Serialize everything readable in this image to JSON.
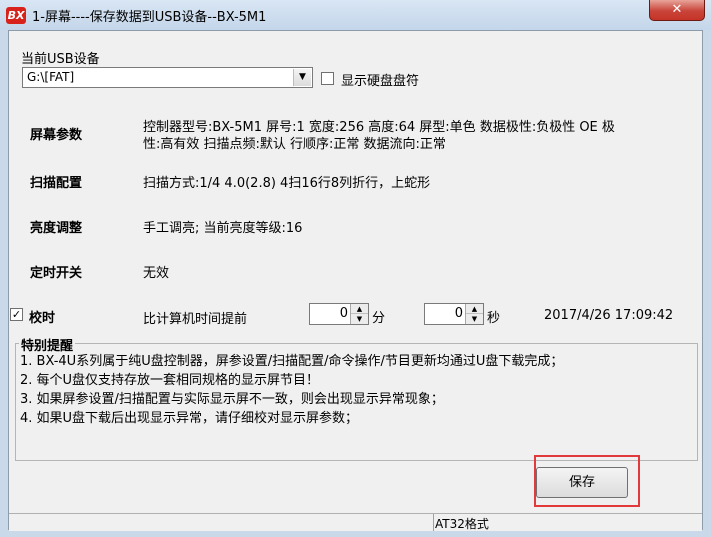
{
  "window": {
    "title": "1-屏幕----保存数据到USB设备--BX-5M1",
    "icon_text": "BX",
    "close_glyph": "✕"
  },
  "usb": {
    "label": "当前USB设备",
    "selected": "G:\\[FAT]",
    "show_drive_letter_label": "显示硬盘盘符",
    "show_drive_letter_checked": false
  },
  "sections": {
    "screen_params": {
      "title": "屏幕参数",
      "line1": "控制器型号:BX-5M1   屏号:1   宽度:256   高度:64   屏型:单色   数据极性:负极性   OE 极",
      "line2": "性:高有效   扫描点频:默认   行顺序:正常   数据流向:正常"
    },
    "scan_config": {
      "title": "扫描配置",
      "value": "扫描方式:1/4     4.0(2.8)  4扫16行8列折行，上蛇形"
    },
    "brightness": {
      "title": "亮度调整",
      "value": "手工调亮; 当前亮度等级:16"
    },
    "timer": {
      "title": "定时开关",
      "value": "无效"
    },
    "calibrate": {
      "title": "校时",
      "checked": true,
      "prefix": "比计算机时间提前",
      "minutes": "0",
      "minutes_unit": "分",
      "seconds": "0",
      "seconds_unit": "秒",
      "datetime": "2017/4/26 17:09:42"
    }
  },
  "notice": {
    "title": "特别提醒",
    "items": [
      "1.  BX-4U系列属于纯U盘控制器，屏参设置/扫描配置/命令操作/节目更新均通过U盘下载完成；",
      "2.  每个U盘仅支持存放一套相同规格的显示屏节目！",
      "3.  如果屏参设置/扫描配置与实际显示屏不一致，则会出现显示异常现象；",
      "4.  如果U盘下载后出现显示异常，请仔细校对显示屏参数；"
    ]
  },
  "save_button": "保存",
  "status": "AT32格式"
}
